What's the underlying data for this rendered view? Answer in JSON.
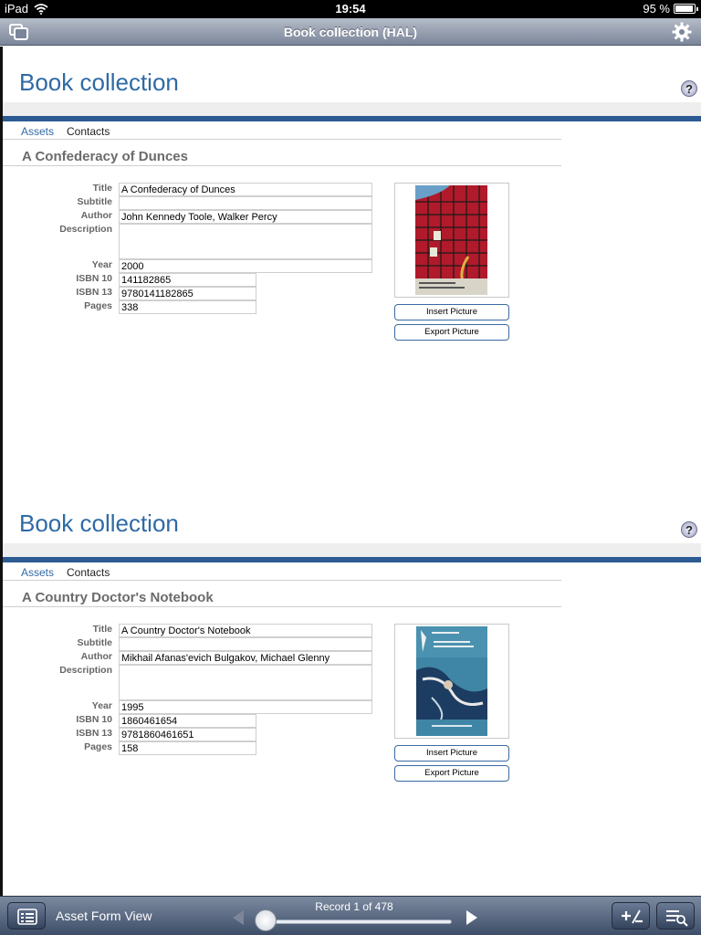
{
  "status": {
    "carrier": "iPad",
    "time": "19:54",
    "battery_text": "95 %",
    "battery_level": 0.95
  },
  "nav": {
    "title": "Book collection (HAL)"
  },
  "records": [
    {
      "header": "Book collection",
      "help": "?",
      "tabs": [
        "Assets",
        "Contacts"
      ],
      "asset_title": "A Confederacy of Dunces",
      "labels": {
        "title": "Title",
        "subtitle": "Subtitle",
        "author": "Author",
        "description": "Description",
        "year": "Year",
        "isbn10": "ISBN 10",
        "isbn13": "ISBN 13",
        "pages": "Pages"
      },
      "values": {
        "title": "A Confederacy of Dunces",
        "subtitle": "",
        "author": "John Kennedy Toole, Walker Percy",
        "description": "",
        "year": "2000",
        "isbn10": "141182865",
        "isbn13": "9780141182865",
        "pages": "338"
      },
      "cover": {
        "bg": "#b01a2a",
        "accent": "#1a1a1a"
      },
      "buttons": {
        "insert": "Insert Picture",
        "export": "Export Picture"
      }
    },
    {
      "header": "Book collection",
      "help": "?",
      "tabs": [
        "Assets",
        "Contacts"
      ],
      "asset_title": "A Country Doctor's Notebook",
      "labels": {
        "title": "Title",
        "subtitle": "Subtitle",
        "author": "Author",
        "description": "Description",
        "year": "Year",
        "isbn10": "ISBN 10",
        "isbn13": "ISBN 13",
        "pages": "Pages"
      },
      "values": {
        "title": "A Country Doctor's Notebook",
        "subtitle": "",
        "author": "Mikhail Afanas'evich Bulgakov, Michael Glenny",
        "description": "",
        "year": "1995",
        "isbn10": "1860461654",
        "isbn13": "9781860461651",
        "pages": "158"
      },
      "cover": {
        "bg": "#3f86a6",
        "accent": "#1d3c61"
      },
      "buttons": {
        "insert": "Insert Picture",
        "export": "Export Picture"
      }
    }
  ],
  "toolbar": {
    "view_label": "Asset Form View",
    "record_text": "Record 1 of 478",
    "position": 0.0
  },
  "colors": {
    "accent": "#2f6aa5",
    "band": "#2c5b93"
  },
  "icons": [
    "wifi-icon",
    "copy-windows-icon",
    "gear-icon",
    "help-icon",
    "list-icon",
    "prev-arrow-icon",
    "next-arrow-icon",
    "plus-minus-icon",
    "search-list-icon"
  ]
}
